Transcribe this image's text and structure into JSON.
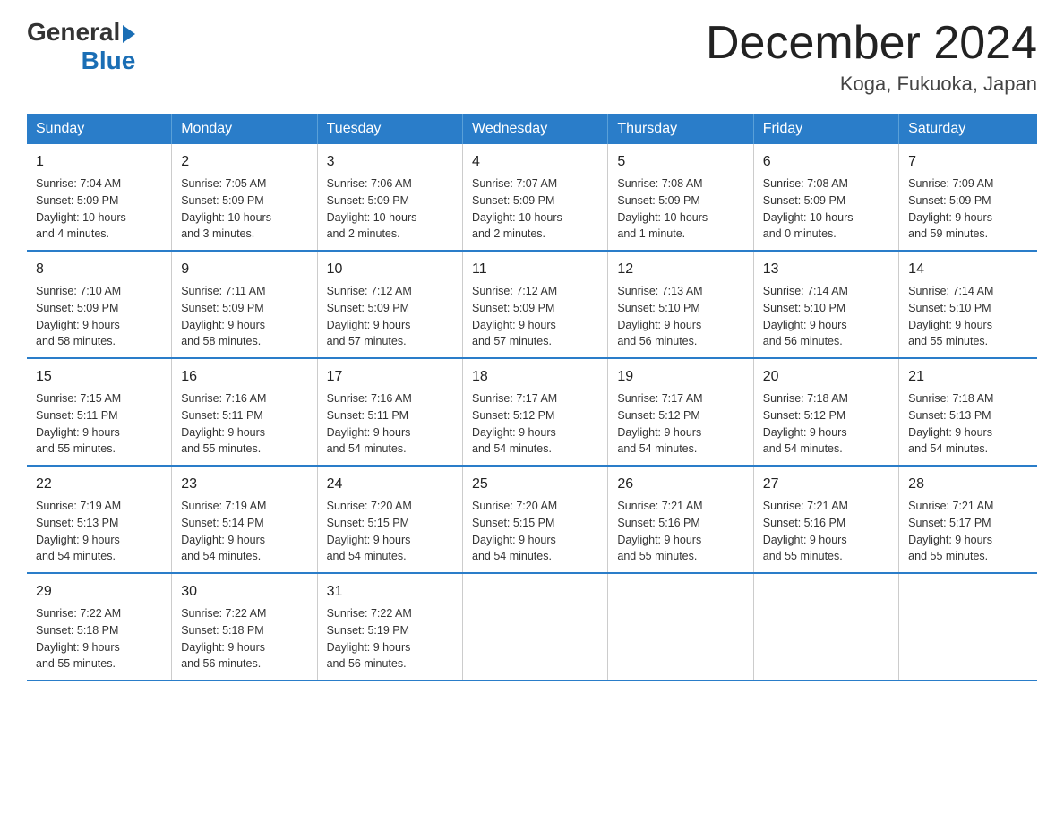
{
  "logo": {
    "general": "General",
    "blue": "Blue",
    "arrow": "▶"
  },
  "title": "December 2024",
  "subtitle": "Koga, Fukuoka, Japan",
  "headers": [
    "Sunday",
    "Monday",
    "Tuesday",
    "Wednesday",
    "Thursday",
    "Friday",
    "Saturday"
  ],
  "weeks": [
    [
      {
        "day": "1",
        "info": "Sunrise: 7:04 AM\nSunset: 5:09 PM\nDaylight: 10 hours\nand 4 minutes."
      },
      {
        "day": "2",
        "info": "Sunrise: 7:05 AM\nSunset: 5:09 PM\nDaylight: 10 hours\nand 3 minutes."
      },
      {
        "day": "3",
        "info": "Sunrise: 7:06 AM\nSunset: 5:09 PM\nDaylight: 10 hours\nand 2 minutes."
      },
      {
        "day": "4",
        "info": "Sunrise: 7:07 AM\nSunset: 5:09 PM\nDaylight: 10 hours\nand 2 minutes."
      },
      {
        "day": "5",
        "info": "Sunrise: 7:08 AM\nSunset: 5:09 PM\nDaylight: 10 hours\nand 1 minute."
      },
      {
        "day": "6",
        "info": "Sunrise: 7:08 AM\nSunset: 5:09 PM\nDaylight: 10 hours\nand 0 minutes."
      },
      {
        "day": "7",
        "info": "Sunrise: 7:09 AM\nSunset: 5:09 PM\nDaylight: 9 hours\nand 59 minutes."
      }
    ],
    [
      {
        "day": "8",
        "info": "Sunrise: 7:10 AM\nSunset: 5:09 PM\nDaylight: 9 hours\nand 58 minutes."
      },
      {
        "day": "9",
        "info": "Sunrise: 7:11 AM\nSunset: 5:09 PM\nDaylight: 9 hours\nand 58 minutes."
      },
      {
        "day": "10",
        "info": "Sunrise: 7:12 AM\nSunset: 5:09 PM\nDaylight: 9 hours\nand 57 minutes."
      },
      {
        "day": "11",
        "info": "Sunrise: 7:12 AM\nSunset: 5:09 PM\nDaylight: 9 hours\nand 57 minutes."
      },
      {
        "day": "12",
        "info": "Sunrise: 7:13 AM\nSunset: 5:10 PM\nDaylight: 9 hours\nand 56 minutes."
      },
      {
        "day": "13",
        "info": "Sunrise: 7:14 AM\nSunset: 5:10 PM\nDaylight: 9 hours\nand 56 minutes."
      },
      {
        "day": "14",
        "info": "Sunrise: 7:14 AM\nSunset: 5:10 PM\nDaylight: 9 hours\nand 55 minutes."
      }
    ],
    [
      {
        "day": "15",
        "info": "Sunrise: 7:15 AM\nSunset: 5:11 PM\nDaylight: 9 hours\nand 55 minutes."
      },
      {
        "day": "16",
        "info": "Sunrise: 7:16 AM\nSunset: 5:11 PM\nDaylight: 9 hours\nand 55 minutes."
      },
      {
        "day": "17",
        "info": "Sunrise: 7:16 AM\nSunset: 5:11 PM\nDaylight: 9 hours\nand 54 minutes."
      },
      {
        "day": "18",
        "info": "Sunrise: 7:17 AM\nSunset: 5:12 PM\nDaylight: 9 hours\nand 54 minutes."
      },
      {
        "day": "19",
        "info": "Sunrise: 7:17 AM\nSunset: 5:12 PM\nDaylight: 9 hours\nand 54 minutes."
      },
      {
        "day": "20",
        "info": "Sunrise: 7:18 AM\nSunset: 5:12 PM\nDaylight: 9 hours\nand 54 minutes."
      },
      {
        "day": "21",
        "info": "Sunrise: 7:18 AM\nSunset: 5:13 PM\nDaylight: 9 hours\nand 54 minutes."
      }
    ],
    [
      {
        "day": "22",
        "info": "Sunrise: 7:19 AM\nSunset: 5:13 PM\nDaylight: 9 hours\nand 54 minutes."
      },
      {
        "day": "23",
        "info": "Sunrise: 7:19 AM\nSunset: 5:14 PM\nDaylight: 9 hours\nand 54 minutes."
      },
      {
        "day": "24",
        "info": "Sunrise: 7:20 AM\nSunset: 5:15 PM\nDaylight: 9 hours\nand 54 minutes."
      },
      {
        "day": "25",
        "info": "Sunrise: 7:20 AM\nSunset: 5:15 PM\nDaylight: 9 hours\nand 54 minutes."
      },
      {
        "day": "26",
        "info": "Sunrise: 7:21 AM\nSunset: 5:16 PM\nDaylight: 9 hours\nand 55 minutes."
      },
      {
        "day": "27",
        "info": "Sunrise: 7:21 AM\nSunset: 5:16 PM\nDaylight: 9 hours\nand 55 minutes."
      },
      {
        "day": "28",
        "info": "Sunrise: 7:21 AM\nSunset: 5:17 PM\nDaylight: 9 hours\nand 55 minutes."
      }
    ],
    [
      {
        "day": "29",
        "info": "Sunrise: 7:22 AM\nSunset: 5:18 PM\nDaylight: 9 hours\nand 55 minutes."
      },
      {
        "day": "30",
        "info": "Sunrise: 7:22 AM\nSunset: 5:18 PM\nDaylight: 9 hours\nand 56 minutes."
      },
      {
        "day": "31",
        "info": "Sunrise: 7:22 AM\nSunset: 5:19 PM\nDaylight: 9 hours\nand 56 minutes."
      },
      {
        "day": "",
        "info": ""
      },
      {
        "day": "",
        "info": ""
      },
      {
        "day": "",
        "info": ""
      },
      {
        "day": "",
        "info": ""
      }
    ]
  ]
}
